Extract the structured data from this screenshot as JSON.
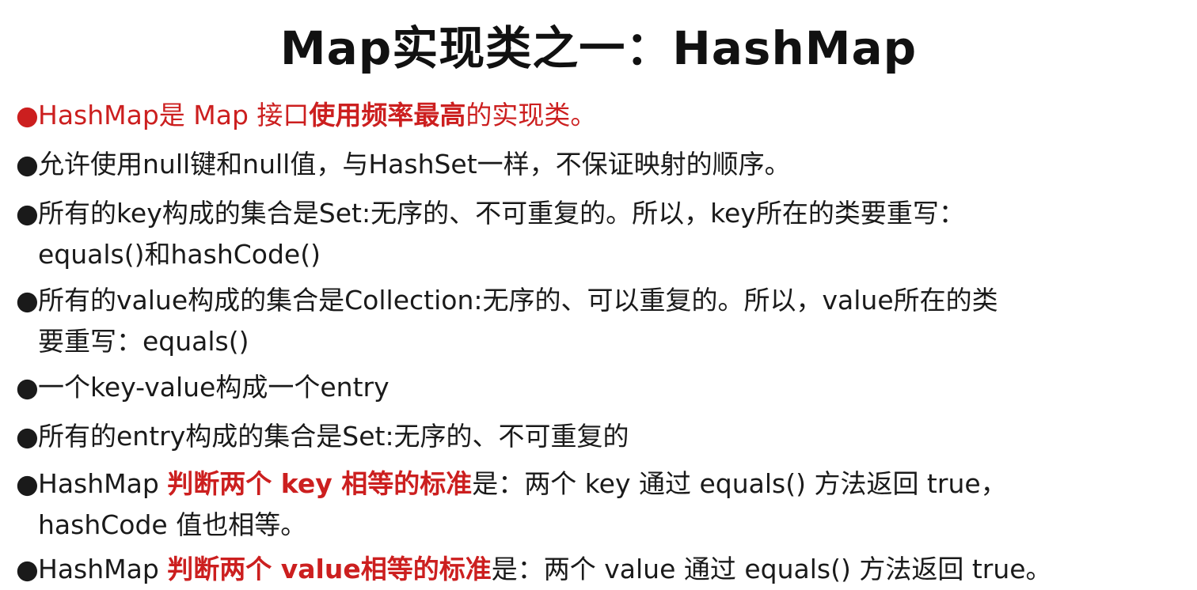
{
  "title": "Map实现类之一：HashMap",
  "bullet_glyph": "●",
  "b1": {
    "p1": "HashMap是 Map 接口",
    "p2": "使用频率最高",
    "p3": "的实现类。"
  },
  "b2": "允许使用null键和null值，与HashSet一样，不保证映射的顺序。",
  "b3": {
    "l1": "所有的key构成的集合是Set:无序的、不可重复的。所以，key所在的类要重写：",
    "l2": "equals()和hashCode()"
  },
  "b4": {
    "l1": "所有的value构成的集合是Collection:无序的、可以重复的。所以，value所在的类",
    "l2": "要重写：equals()"
  },
  "b5": "一个key-value构成一个entry",
  "b6": "所有的entry构成的集合是Set:无序的、不可重复的",
  "b7": {
    "p1": "HashMap ",
    "p2": "判断两个 key 相等的标准",
    "p3": "是：两个 key 通过 equals() 方法返回 true，",
    "l2": "hashCode 值也相等。"
  },
  "b8": {
    "p1": "HashMap ",
    "p2": "判断两个 value相等的标准",
    "p3": "是：两个 value 通过 equals() 方法返回 true。"
  }
}
